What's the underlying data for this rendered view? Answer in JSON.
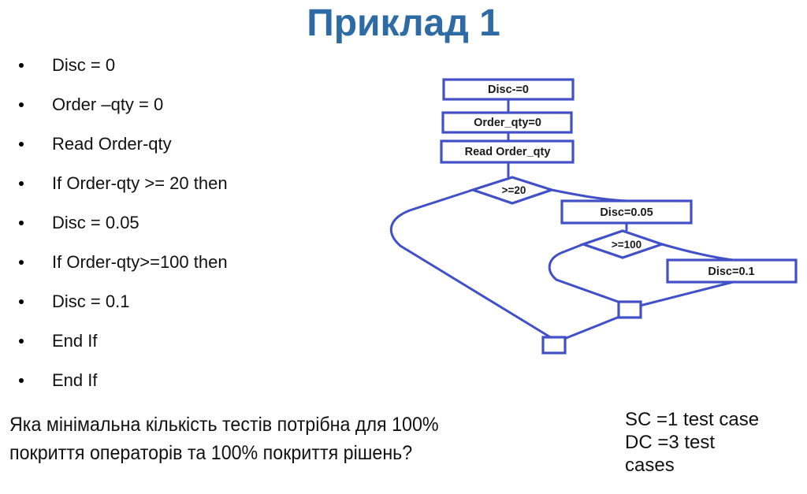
{
  "title": "Приклад 1",
  "bullets": [
    {
      "text": "Disc = 0"
    },
    {
      "text": "Order –qty = 0"
    },
    {
      "text": "Read Order-qty"
    },
    {
      "text": "If Order-qty >= 20 then"
    },
    {
      "text": "Disc = 0.05"
    },
    {
      "text": "If Order-qty>=100 then"
    },
    {
      "text": "Disc = 0.1"
    },
    {
      "text": "End If"
    },
    {
      "text": "End If"
    }
  ],
  "question": {
    "line1": "Яка мінімальна кількість тестів потрібна для 100%",
    "line2": "покриття операторів та 100% покриття рішень?"
  },
  "answer": {
    "line1": "SC =1 test case",
    "line2": "DC =3 test",
    "line3": "cases"
  },
  "flowchart": {
    "accent_color": "#4250c8",
    "nodes": [
      {
        "id": "n1",
        "type": "process",
        "label": "Disc-=0"
      },
      {
        "id": "n2",
        "type": "process",
        "label": "Order_qty=0"
      },
      {
        "id": "n3",
        "type": "process",
        "label": "Read Order_qty"
      },
      {
        "id": "d1",
        "type": "decision",
        "label": ">=20"
      },
      {
        "id": "n4",
        "type": "process",
        "label": "Disc=0.05"
      },
      {
        "id": "d2",
        "type": "decision",
        "label": ">=100"
      },
      {
        "id": "n5",
        "type": "process",
        "label": "Disc=0.1"
      },
      {
        "id": "j1",
        "type": "junction",
        "label": ""
      },
      {
        "id": "j2",
        "type": "junction",
        "label": ""
      }
    ],
    "edges": [
      {
        "from": "n1",
        "to": "n2"
      },
      {
        "from": "n2",
        "to": "n3"
      },
      {
        "from": "n3",
        "to": "d1"
      },
      {
        "from": "d1",
        "to": "n4",
        "branch": "true"
      },
      {
        "from": "d1",
        "to": "j2",
        "branch": "false"
      },
      {
        "from": "n4",
        "to": "d2"
      },
      {
        "from": "d2",
        "to": "n5",
        "branch": "true"
      },
      {
        "from": "d2",
        "to": "j1",
        "branch": "false"
      },
      {
        "from": "n5",
        "to": "j1"
      },
      {
        "from": "j1",
        "to": "j2"
      }
    ]
  },
  "chart_data": {
    "type": "diagram",
    "title": "Control flow graph for discount pseudocode",
    "nodes": [
      "Disc-=0",
      "Order_qty=0",
      "Read Order_qty",
      ">=20",
      "Disc=0.05",
      ">=100",
      "Disc=0.1",
      "junction-1",
      "junction-2"
    ],
    "statement_coverage_tests": 1,
    "decision_coverage_tests": 3
  }
}
